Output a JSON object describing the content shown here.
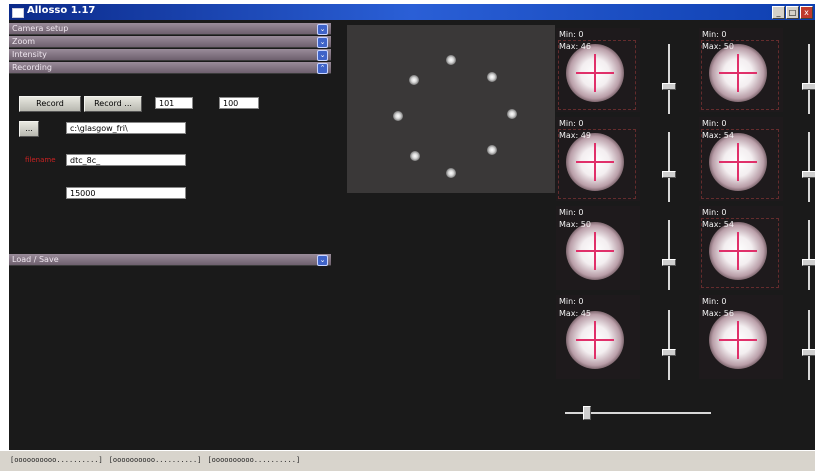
{
  "window": {
    "title": "Allosso 1.17",
    "controls": [
      "_",
      "□",
      "x"
    ]
  },
  "sections": {
    "camera_setup": "Camera setup",
    "zoom": "Zoom",
    "intensity": "Intensity",
    "recording": "Recording",
    "load_save": "Load / Save"
  },
  "recording": {
    "record_label": "Record",
    "record_dots_label": "Record ...",
    "field_a": "101",
    "field_b": "100",
    "browse_label": "...",
    "path": "c:\\glasgow_fri\\",
    "name_label": "filename",
    "prefix": "dtc_8c_",
    "frames": "15000"
  },
  "tiles": [
    {
      "min": "Min: 0",
      "max": "Max: 46",
      "slider_level": 0.38
    },
    {
      "min": "Min: 0",
      "max": "Max: 50",
      "slider_level": 0.38
    },
    {
      "min": "Min: 0",
      "max": "Max: 49",
      "slider_level": 0.38
    },
    {
      "min": "Min: 0",
      "max": "Max: 54",
      "slider_level": 0.38
    },
    {
      "min": "Min: 0",
      "max": "Max: 50",
      "slider_level": 0.38
    },
    {
      "min": "Min: 0",
      "max": "Max: 54",
      "slider_level": 0.38
    },
    {
      "min": "Min: 0",
      "max": "Max: 45",
      "slider_level": 0.38
    },
    {
      "min": "Min: 0",
      "max": "Max: 56",
      "slider_level": 0.38
    }
  ],
  "bottom_slider": {
    "level": 0.13
  },
  "statusbar": [
    "[oooooooooo..........]",
    "[oooooooooo..........]",
    "[oooooooooo..........]"
  ]
}
